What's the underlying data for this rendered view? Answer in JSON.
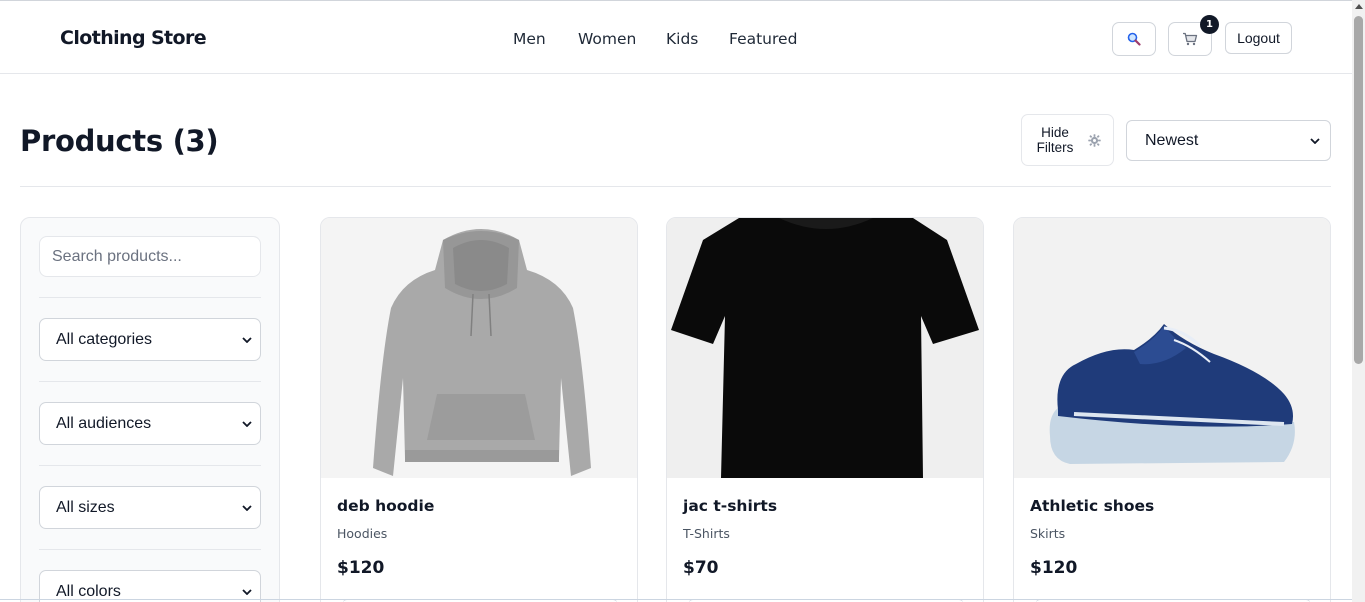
{
  "header": {
    "brand": "Clothing Store",
    "nav": [
      {
        "label": "Men"
      },
      {
        "label": "Women"
      },
      {
        "label": "Kids"
      },
      {
        "label": "Featured"
      }
    ],
    "search_icon": "magnifier-icon",
    "cart_icon": "cart-icon",
    "cart_count": "1",
    "logout_label": "Logout"
  },
  "main": {
    "title": "Products (3)",
    "hide_filters_label": "Hide Filters",
    "sort_value": "Newest"
  },
  "filters": {
    "search_placeholder": "Search products...",
    "category": "All categories",
    "audience": "All audiences",
    "size": "All sizes",
    "color": "All colors"
  },
  "products": [
    {
      "name": "deb hoodie",
      "category": "Hoodies",
      "price": "$120",
      "image": "grey-hoodie"
    },
    {
      "name": "jac t-shirts",
      "category": "T-Shirts",
      "price": "$70",
      "image": "black-tshirt"
    },
    {
      "name": "Athletic shoes",
      "category": "Skirts",
      "price": "$120",
      "image": "navy-sneaker"
    }
  ],
  "colors": {
    "text": "#111827",
    "border": "#e5e7eb",
    "muted": "#4b5563",
    "badge": "#111827"
  }
}
